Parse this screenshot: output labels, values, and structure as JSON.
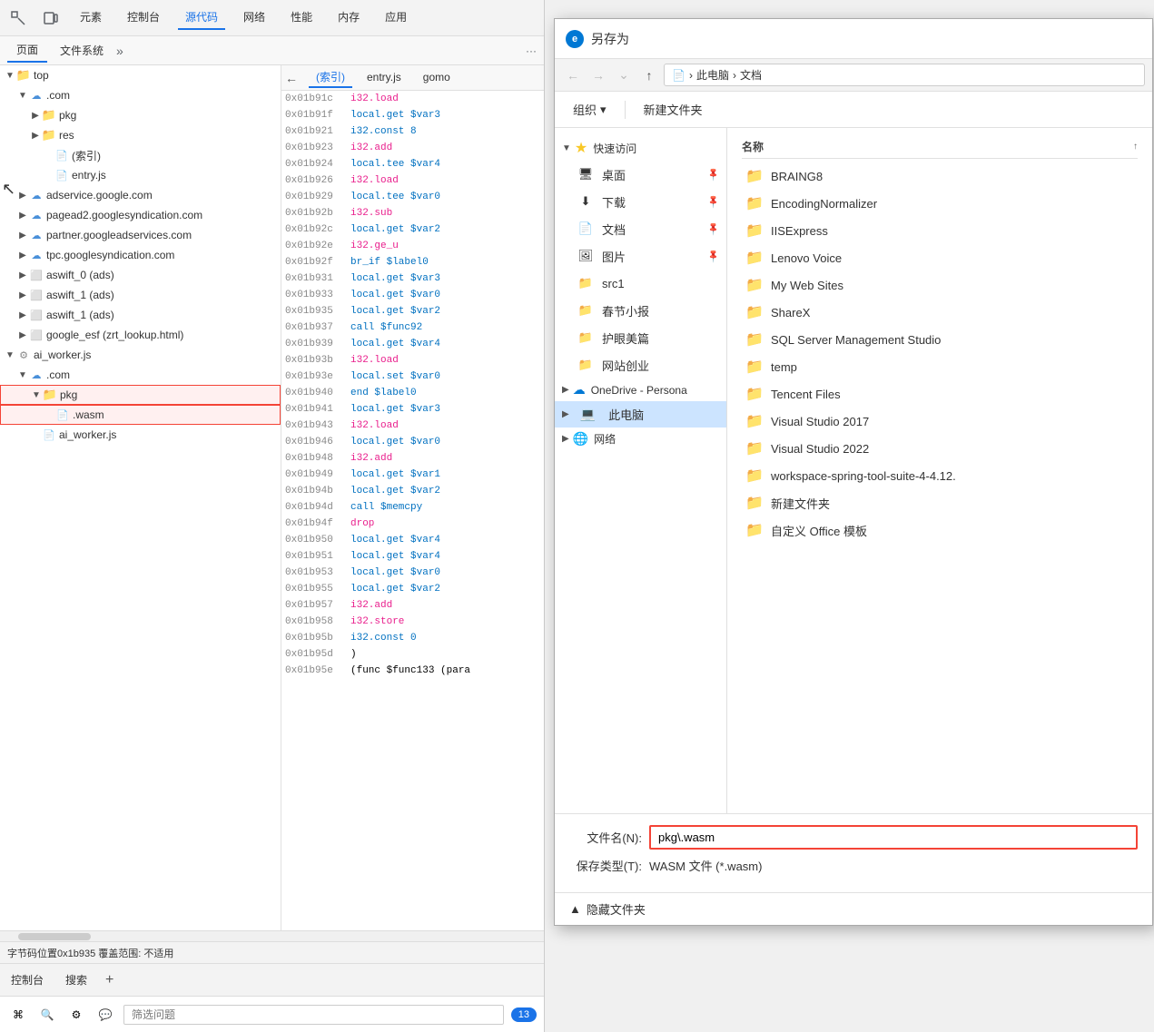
{
  "devtools": {
    "tabs": [
      "元素",
      "控制台",
      "源代码",
      "网络",
      "性能",
      "内存",
      "应用"
    ],
    "active_tab": "源代码",
    "icons": [
      "inspect",
      "device"
    ],
    "subtabs": [
      "页面",
      "文件系统"
    ],
    "active_subtab": "页面",
    "code_tabs": [
      "(索引)",
      "entry.js",
      "gomo"
    ],
    "active_code_tab": "(索引)",
    "code_icon": "←",
    "file_tree": [
      {
        "id": "top",
        "label": "top",
        "level": 0,
        "type": "root",
        "expanded": true
      },
      {
        "id": "domain1",
        "label": ".com",
        "level": 1,
        "type": "cloud",
        "expanded": true
      },
      {
        "id": "pkg",
        "label": "pkg",
        "level": 2,
        "type": "folder",
        "expanded": false
      },
      {
        "id": "res",
        "label": "res",
        "level": 2,
        "type": "folder",
        "expanded": false
      },
      {
        "id": "index",
        "label": "(索引)",
        "level": 2,
        "type": "file"
      },
      {
        "id": "entry",
        "label": "entry.js",
        "level": 2,
        "type": "file"
      },
      {
        "id": "adservice",
        "label": "adservice.google.com",
        "level": 1,
        "type": "cloud"
      },
      {
        "id": "pagead",
        "label": "pagead2.googlesyndication.com",
        "level": 1,
        "type": "cloud"
      },
      {
        "id": "partner",
        "label": "partner.googleadservices.com",
        "level": 1,
        "type": "cloud"
      },
      {
        "id": "tpc",
        "label": "tpc.googlesyndication.com",
        "level": 1,
        "type": "cloud"
      },
      {
        "id": "aswift0",
        "label": "aswift_0 (ads)",
        "level": 1,
        "type": "frame"
      },
      {
        "id": "aswift1a",
        "label": "aswift_1 (ads)",
        "level": 1,
        "type": "frame"
      },
      {
        "id": "aswift1b",
        "label": "aswift_1 (ads)",
        "level": 1,
        "type": "frame"
      },
      {
        "id": "google_esf",
        "label": "google_esf (zrt_lookup.html)",
        "level": 1,
        "type": "frame"
      },
      {
        "id": "ai_worker",
        "label": "ai_worker.js",
        "level": 0,
        "type": "cog",
        "expanded": true
      },
      {
        "id": "domain2",
        "label": ".com",
        "level": 1,
        "type": "cloud",
        "expanded": true
      },
      {
        "id": "pkg2",
        "label": "pkg",
        "level": 2,
        "type": "folder_highlighted",
        "expanded": true
      },
      {
        "id": "wasm_file",
        "label": ".wasm",
        "level": 3,
        "type": "file_highlighted"
      },
      {
        "id": "ai_worker_js",
        "label": "ai_worker.js",
        "level": 2,
        "type": "file"
      }
    ],
    "code_lines": [
      {
        "addr": "0x01b91c",
        "code": "i32.load",
        "color": "pink"
      },
      {
        "addr": "0x01b91f",
        "code": "local.get $var3",
        "color": "blue"
      },
      {
        "addr": "0x01b921",
        "code": "i32.const 8",
        "color": "blue"
      },
      {
        "addr": "0x01b923",
        "code": "i32.add",
        "color": "pink"
      },
      {
        "addr": "0x01b924",
        "code": "local.tee $var4",
        "color": "blue"
      },
      {
        "addr": "0x01b926",
        "code": "i32.load",
        "color": "pink"
      },
      {
        "addr": "0x01b929",
        "code": "local.tee $var0",
        "color": "blue"
      },
      {
        "addr": "0x01b92b",
        "code": "i32.sub",
        "color": "pink"
      },
      {
        "addr": "0x01b92c",
        "code": "local.get $var2",
        "color": "blue"
      },
      {
        "addr": "0x01b92e",
        "code": "i32.ge_u",
        "color": "pink"
      },
      {
        "addr": "0x01b92f",
        "code": "br_if $label0",
        "color": "blue"
      },
      {
        "addr": "0x01b931",
        "code": "local.get $var3",
        "color": "blue"
      },
      {
        "addr": "0x01b933",
        "code": "local.get $var0",
        "color": "blue"
      },
      {
        "addr": "0x01b935",
        "code": "local.get $var2",
        "color": "blue"
      },
      {
        "addr": "0x01b937",
        "code": "call $func92",
        "color": "blue"
      },
      {
        "addr": "0x01b939",
        "code": "local.get $var4",
        "color": "blue"
      },
      {
        "addr": "0x01b93b",
        "code": "i32.load",
        "color": "pink"
      },
      {
        "addr": "0x01b93e",
        "code": "local.set $var0",
        "color": "blue"
      },
      {
        "addr": "0x01b940",
        "code": "end $label0",
        "color": "blue"
      },
      {
        "addr": "0x01b941",
        "code": "local.get $var3",
        "color": "blue"
      },
      {
        "addr": "0x01b943",
        "code": "i32.load",
        "color": "pink"
      },
      {
        "addr": "0x01b946",
        "code": "local.get $var0",
        "color": "blue"
      },
      {
        "addr": "0x01b948",
        "code": "i32.add",
        "color": "pink"
      },
      {
        "addr": "0x01b949",
        "code": "local.get $var1",
        "color": "blue"
      },
      {
        "addr": "0x01b94b",
        "code": "local.get $var2",
        "color": "blue"
      },
      {
        "addr": "0x01b94d",
        "code": "call $memcpy",
        "color": "blue"
      },
      {
        "addr": "0x01b94f",
        "code": "drop",
        "color": "pink"
      },
      {
        "addr": "0x01b950",
        "code": "local.get $var4",
        "color": "blue"
      },
      {
        "addr": "0x01b951",
        "code": "local.get $var4",
        "color": "blue"
      },
      {
        "addr": "0x01b953",
        "code": "local.get $var0",
        "color": "blue"
      },
      {
        "addr": "0x01b955",
        "code": "local.get $var2",
        "color": "blue"
      },
      {
        "addr": "0x01b957",
        "code": "i32.add",
        "color": "pink"
      },
      {
        "addr": "0x01b958",
        "code": "i32.store",
        "color": "pink"
      },
      {
        "addr": "0x01b95b",
        "code": "i32.const 0",
        "color": "blue"
      },
      {
        "addr": "0x01b95d",
        "code": ")",
        "color": "default"
      },
      {
        "addr": "0x01b95e",
        "code": "(func $func133 (para",
        "color": "default"
      }
    ],
    "status_bar": "字节码位置0x1b935  覆盖范围: 不适用",
    "bottom_tabs": [
      "控制台",
      "搜索"
    ],
    "input_placeholder": "筛选问题"
  },
  "save_dialog": {
    "title": "另存为",
    "title_icon": "e",
    "nav": {
      "back_disabled": true,
      "forward_disabled": true,
      "up_label": "↑",
      "breadcrumb": [
        "此电脑",
        "文档"
      ]
    },
    "toolbar": {
      "organize_label": "组织",
      "new_folder_label": "新建文件夹"
    },
    "left_nav": {
      "quick_access_label": "快速访问",
      "quick_access_expanded": true,
      "items": [
        {
          "label": "桌面",
          "pinned": true,
          "icon": "desktop"
        },
        {
          "label": "下载",
          "pinned": true,
          "icon": "download"
        },
        {
          "label": "文档",
          "pinned": true,
          "icon": "doc"
        },
        {
          "label": "图片",
          "pinned": true,
          "icon": "pic"
        },
        {
          "label": "src1",
          "icon": "folder"
        },
        {
          "label": "春节小报",
          "icon": "folder"
        },
        {
          "label": "护眼美篇",
          "icon": "folder"
        },
        {
          "label": "网站创业",
          "icon": "folder"
        }
      ],
      "onedrive_label": "OneDrive - Persona",
      "pc_label": "此电脑",
      "pc_selected": true,
      "network_label": "网络"
    },
    "file_list": {
      "col_name": "名称",
      "col_sort": "↑",
      "files": [
        {
          "name": "BRAING8",
          "type": "folder"
        },
        {
          "name": "EncodingNormalizer",
          "type": "folder"
        },
        {
          "name": "IISExpress",
          "type": "folder"
        },
        {
          "name": "Lenovo Voice",
          "type": "folder"
        },
        {
          "name": "My Web Sites",
          "type": "folder"
        },
        {
          "name": "ShareX",
          "type": "folder"
        },
        {
          "name": "SQL Server Management Studio",
          "type": "folder"
        },
        {
          "name": "temp",
          "type": "folder"
        },
        {
          "name": "Tencent Files",
          "type": "folder"
        },
        {
          "name": "Visual Studio 2017",
          "type": "folder"
        },
        {
          "name": "Visual Studio 2022",
          "type": "folder"
        },
        {
          "name": "workspace-spring-tool-suite-4-4.12.",
          "type": "folder"
        },
        {
          "name": "新建文件夹",
          "type": "folder"
        },
        {
          "name": "自定义 Office 模板",
          "type": "folder"
        }
      ]
    },
    "bottom": {
      "filename_label": "文件名(N):",
      "filename_value": "pkg\\.wasm",
      "filetype_label": "保存类型(T):",
      "filetype_value": "WASM 文件 (*.wasm)"
    },
    "toggle_row": {
      "label": "隐藏文件夹",
      "arrow": "▲"
    }
  }
}
